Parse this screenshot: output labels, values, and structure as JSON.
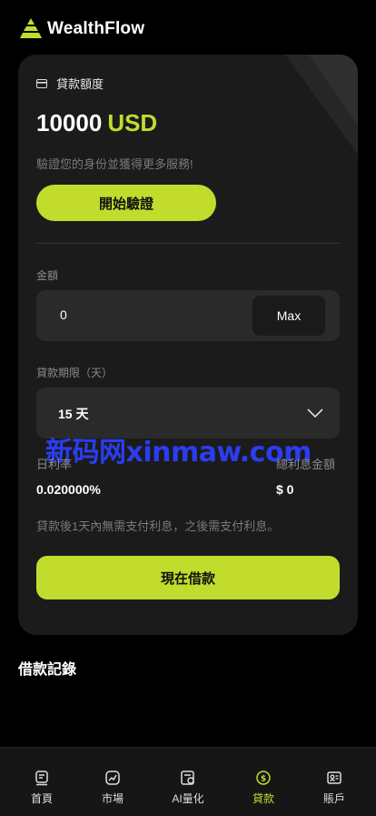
{
  "app": {
    "brand": "WealthFlow"
  },
  "loan_card": {
    "quota_label": "貸款額度",
    "amount_value": "10000",
    "amount_currency": "USD",
    "verify_hint": "驗證您的身份並獲得更多服務!",
    "verify_button": "開始驗證",
    "amount_label": "金額",
    "amount_input_value": "0",
    "max_button": "Max",
    "term_label": "貸款期限（天）",
    "term_selected": "15 天",
    "daily_rate_label": "日利率",
    "daily_rate_value": "0.020000%",
    "total_interest_label": "總利息金額",
    "total_interest_value": "$ 0",
    "note": "貸款後1天內無需支付利息，之後需支付利息。",
    "borrow_button": "現在借款"
  },
  "watermark": "新码网xinmaw.com",
  "records": {
    "title": "借款記錄"
  },
  "colors": {
    "accent": "#c1dc2d",
    "background": "#000000",
    "card": "#1b1b1b"
  },
  "tabbar": {
    "items": [
      {
        "label": "首頁",
        "icon": "home-icon"
      },
      {
        "label": "市場",
        "icon": "chart-icon"
      },
      {
        "label": "AI量化",
        "icon": "ai-icon"
      },
      {
        "label": "貸款",
        "icon": "loan-icon",
        "active": true
      },
      {
        "label": "賬戶",
        "icon": "account-icon"
      }
    ]
  }
}
